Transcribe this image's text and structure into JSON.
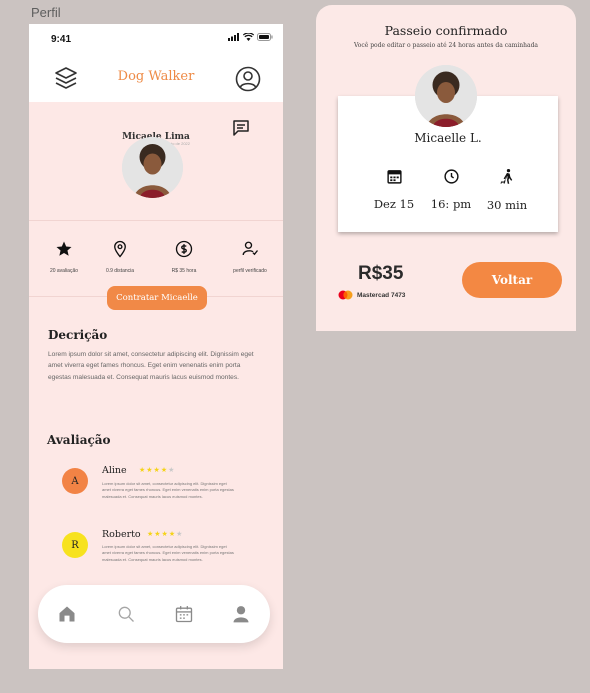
{
  "frame": {
    "label": "Perfil"
  },
  "status_bar": {
    "time": "9:41"
  },
  "app": {
    "title": "Dog Walker"
  },
  "profile": {
    "name": "Micaele Lima",
    "subtitle": "Agosto de 2022",
    "stats": [
      {
        "icon": "star-icon",
        "label": "20 avaliação"
      },
      {
        "icon": "location-pin-icon",
        "label": "0.9 distancia"
      },
      {
        "icon": "dollar-icon",
        "label": "R$ 35 hora"
      },
      {
        "icon": "verified-user-icon",
        "label": "perfil verificado"
      }
    ],
    "hire_button": "Contratar Micaelle"
  },
  "description": {
    "title": "Decrição",
    "text": "Lorem ipsum dolor sit amet, consectetur adipiscing elit. Dignissim eget amet viverra eget fames rhoncus. Eget enim venenatis enim porta egestas malesuada et. Consequat mauris lacus euismod montes."
  },
  "reviews": {
    "title": "Avaliação",
    "items": [
      {
        "initial": "A",
        "name": "Aline",
        "stars": "★★★★",
        "empty_stars": "★",
        "avatar_color": "#f28345",
        "text": "Lorem ipsum dolor sit amet, consectetur adipiscing elit. Dignissim eget amet viverra eget fames rhoncus. Eget enim venenatis enim porta egestas malesuada et. Consequat mauris lacus euismod montes."
      },
      {
        "initial": "R",
        "name": "Roberto",
        "stars": "★★★★",
        "empty_stars": "★",
        "avatar_color": "#f7e21e",
        "text": "Lorem ipsum dolor sit amet, consectetur adipiscing elit. Dignissim eget amet viverra eget fames rhoncus. Eget enim venenatis enim porta egestas malesuada et. Consequat mauris lacus euismod montes."
      }
    ]
  },
  "bottom_nav": [
    "home-icon",
    "search-icon",
    "calendar-icon",
    "profile-icon"
  ],
  "confirmation": {
    "title": "Passeio confirmado",
    "subtitle": "Você pode editar o passeio até 24 horas antes da caminhada",
    "walker_name": "Micaelle L.",
    "date": "Dez 15",
    "time": "16: pm",
    "duration": "30 min",
    "price": "R$35",
    "card": "Mastercad 7473",
    "back_button": "Voltar"
  },
  "colors": {
    "accent": "#f18947",
    "background": "#fde8e6",
    "star": "#f5d319"
  }
}
